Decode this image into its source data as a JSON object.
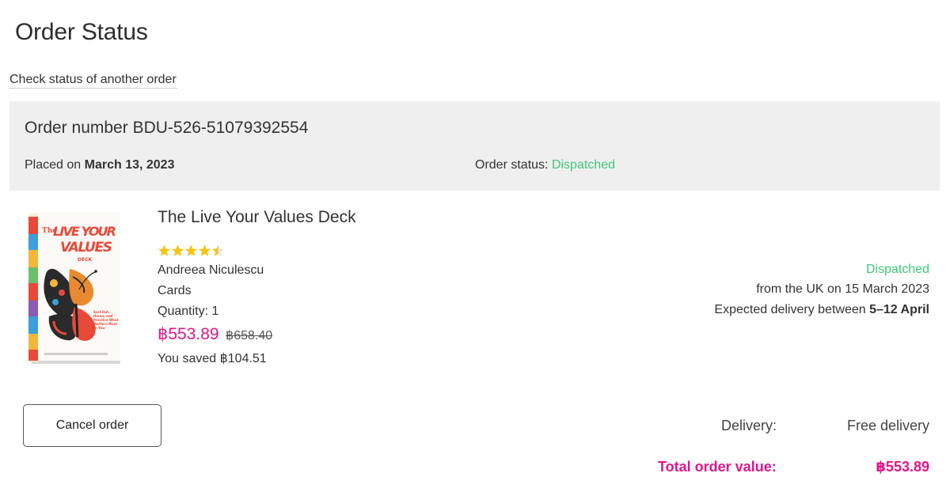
{
  "page": {
    "title": "Order Status",
    "check_link": "Check status of another order"
  },
  "order": {
    "number_label": "Order number",
    "number": "BDU-526-51079392554",
    "placed_label": "Placed on",
    "placed_date": "March 13, 2023",
    "status_label": "Order status:",
    "status": "Dispatched"
  },
  "item": {
    "title": "The Live Your Values Deck",
    "rating": 4.5,
    "rating_max": 5,
    "author": "Andreea Niculescu",
    "format": "Cards",
    "quantity": "Quantity: 1",
    "price": "฿553.89",
    "original_price": "฿658.40",
    "saved": "You saved ฿104.51",
    "cover_title_lines": [
      "The",
      "LIVE YOUR",
      "VALUES",
      "DECK"
    ],
    "cover_text": "Sort Out, Honor, and Practice What Matters Most to You"
  },
  "shipping": {
    "status": "Dispatched",
    "from": "from the UK on 15 March 2023",
    "expected_prefix": "Expected delivery between",
    "expected_range": "5–12 April"
  },
  "actions": {
    "cancel_label": "Cancel order"
  },
  "summary": {
    "delivery_label": "Delivery:",
    "delivery_value": "Free delivery",
    "total_label": "Total order value:",
    "total_value": "฿553.89"
  },
  "colors": {
    "accent_pink": "#e0178a",
    "status_green": "#3fc77a",
    "header_bg": "#efefef",
    "star": "#f5c518"
  },
  "icons": {
    "star": "star-icon",
    "half_star": "half-star-icon"
  }
}
